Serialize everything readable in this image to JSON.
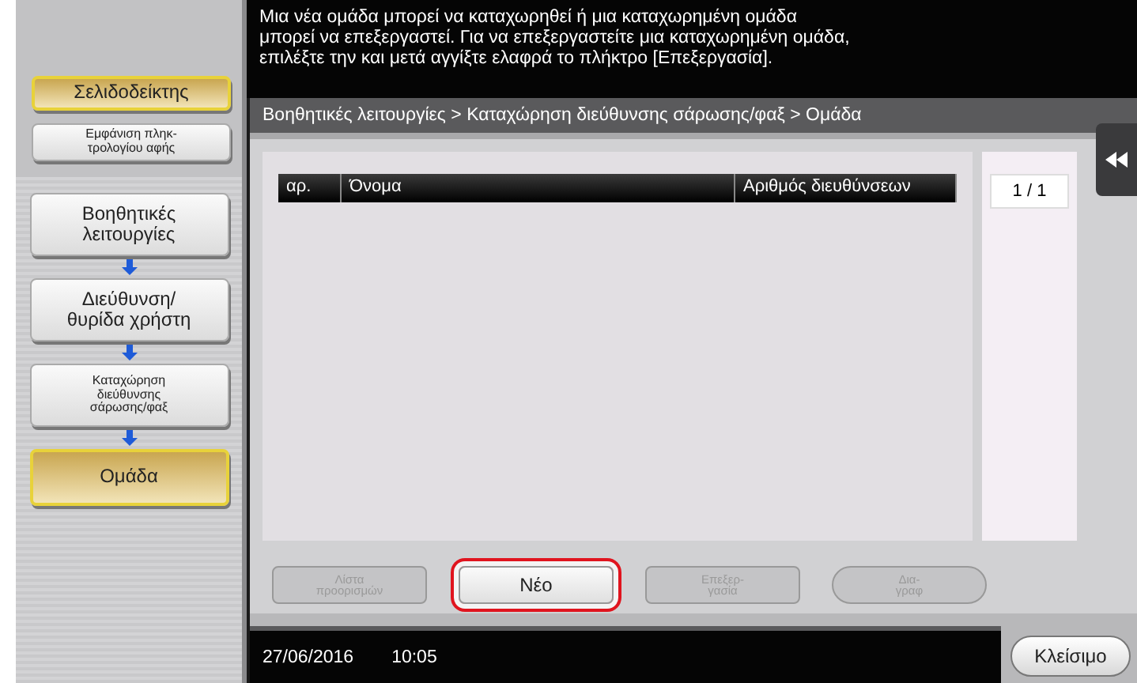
{
  "message": "Μια νέα ομάδα μπορεί να καταχωρηθεί ή μια καταχωρημένη ομάδα\nμπορεί να επεξεργαστεί. Για να επεξεργαστείτε μια καταχωρημένη ομάδα,\nεπιλέξτε την και μετά αγγίξτε ελαφρά το πλήκτρο [Επεξεργασία].",
  "sidebar": {
    "top": [
      {
        "label": "Σελιδοδείκτης",
        "selected": true,
        "small": false
      },
      {
        "label": "Εμφάνιση πληκ-\nτρολογίου αφής",
        "selected": false,
        "small": true
      }
    ],
    "path": [
      {
        "label": "Βοηθητικές\nλειτουργίες",
        "selected": false,
        "small": false
      },
      {
        "label": "Διεύθυνση/\nθυρίδα χρήστη",
        "selected": false,
        "small": false
      },
      {
        "label": "Καταχώρηση\nδιεύθυνσης\nσάρωσης/φαξ",
        "selected": false,
        "small": true
      },
      {
        "label": "Ομάδα",
        "selected": true,
        "small": false
      }
    ]
  },
  "breadcrumb": "Βοηθητικές λειτουργίες > Καταχώρηση διεύθυνσης σάρωσης/φαξ > Ομάδα",
  "table": {
    "columns": [
      "αρ.",
      "Όνομα",
      "Αριθμός διευθύνσεων"
    ]
  },
  "page_counter": "1  /  1",
  "actions": [
    {
      "label": "Λίστα\nπροορισμών",
      "disabled": true,
      "highlighted": false,
      "kind": "rect"
    },
    {
      "label": "Νέο",
      "disabled": false,
      "highlighted": true,
      "kind": "rect"
    },
    {
      "label": "Επεξερ-\nγασία",
      "disabled": true,
      "highlighted": false,
      "kind": "rect"
    },
    {
      "label": "Δια-\nγραφ",
      "disabled": true,
      "highlighted": false,
      "kind": "pill"
    }
  ],
  "status_bar": {
    "date": "27/06/2016",
    "time": "10:05"
  },
  "close_button": "Κλείσιμο"
}
